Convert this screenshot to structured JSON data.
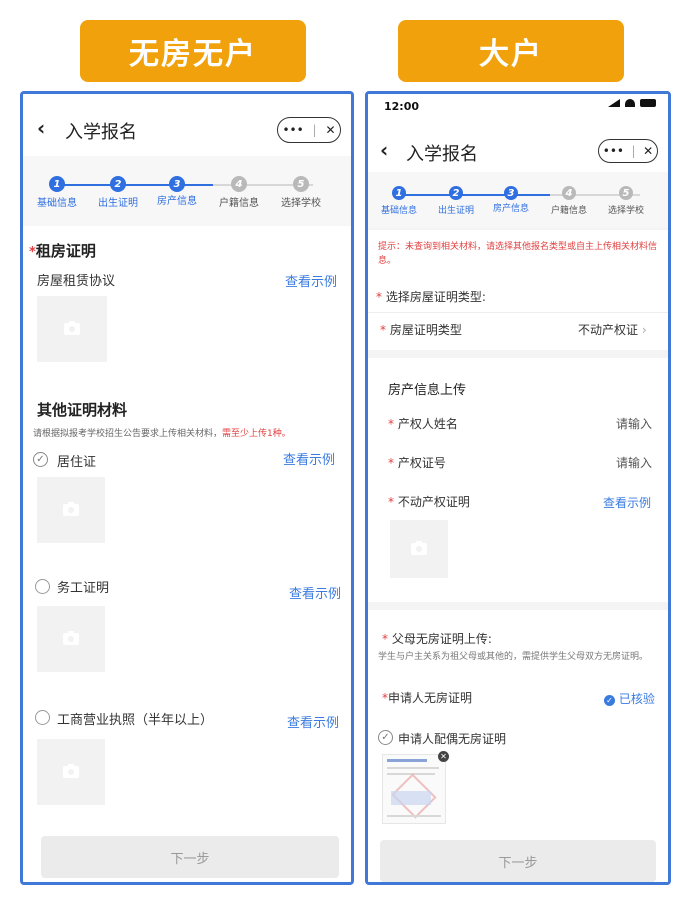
{
  "tags": {
    "left": "无房无户",
    "right": "大户"
  },
  "left": {
    "title": "入学报名",
    "capsule": {
      "more": "•••",
      "sep": "|",
      "close": "✕"
    },
    "steps": [
      "基础信息",
      "出生证明",
      "房产信息",
      "户籍信息",
      "选择学校"
    ],
    "step_nums": [
      "1",
      "2",
      "3",
      "4",
      "5"
    ],
    "rent_section": "租房证明",
    "rent_doc": "房屋租赁协议",
    "view_example": "查看示例",
    "other_section": "其他证明材料",
    "other_hint": "请根据拟报考学校招生公告要求上传相关材料，",
    "other_hint_red": "需至少上传1种。",
    "items": [
      "居住证",
      "务工证明",
      "工商营业执照（半年以上）"
    ],
    "next": "下一步"
  },
  "right": {
    "time": "12:00",
    "title": "入学报名",
    "capsule": {
      "more": "•••",
      "sep": "|",
      "close": "✕"
    },
    "steps": [
      "基础信息",
      "出生证明",
      "房产信息",
      "户籍信息",
      "选择学校"
    ],
    "step_nums": [
      "1",
      "2",
      "3",
      "4",
      "5"
    ],
    "notice": "提示：未查询到相关材料，请选择其他报名类型或自主上传相关材料信息。",
    "select_type_label": "选择房屋证明类型:",
    "cert_type_label": "房屋证明类型",
    "cert_type_value": "不动产权证",
    "house_upload_title": "房产信息上传",
    "owner_name_label": "产权人姓名",
    "owner_name_placeholder": "请输入",
    "cert_no_label": "产权证号",
    "cert_no_placeholder": "请输入",
    "property_cert_label": "不动产权证明",
    "view_example": "查看示例",
    "parents_title": "父母无房证明上传:",
    "parents_hint": "学生与户主关系为祖父母或其他的，需提供学生父母双方无房证明。",
    "applicant_label": "申请人无房证明",
    "verified": "已核验",
    "spouse_label": "申请人配偶无房证明",
    "next": "下一步"
  }
}
